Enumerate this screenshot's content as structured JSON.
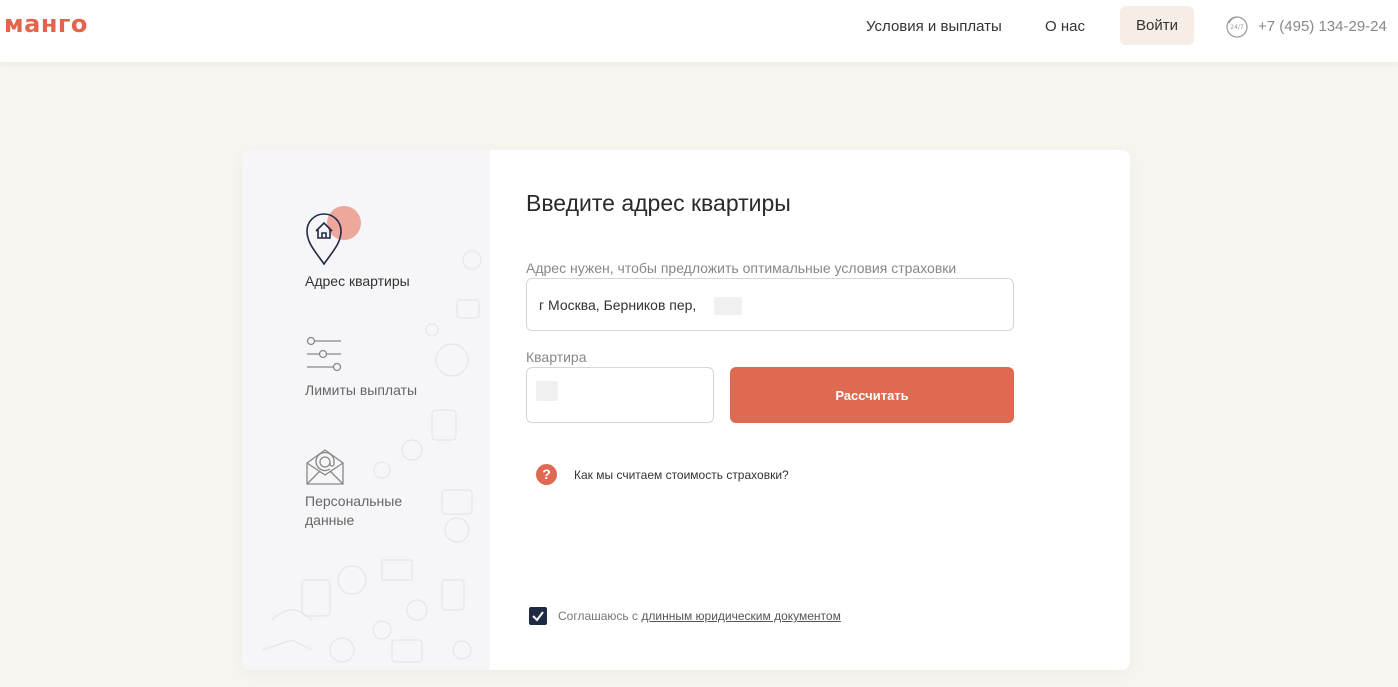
{
  "header": {
    "logo": "манго",
    "nav": {
      "terms": "Условия и выплаты",
      "about": "О нас"
    },
    "login_label": "Войти",
    "phone": "+7 (495) 134-29-24",
    "support_icon": "support-24-7-icon",
    "support_badge": "24/7"
  },
  "sidebar": {
    "steps": [
      {
        "label": "Адрес квартиры",
        "icon": "home-pin-icon",
        "active": true
      },
      {
        "label": "Лимиты выплаты",
        "icon": "sliders-icon",
        "active": false
      },
      {
        "label": "Персональные данные",
        "icon": "envelope-at-icon",
        "active": false
      }
    ]
  },
  "form": {
    "title": "Введите адрес квартиры",
    "address_hint": "Адрес нужен, чтобы предложить оптимальные условия страховки",
    "address_value": "г Москва, Берников пер,",
    "apartment_label": "Квартира",
    "apartment_value": "",
    "calculate_label": "Рассчитать",
    "help_text": "Как мы считаем стоимость страховки?",
    "agree_prefix": "Соглашаюсь с ",
    "agree_link": "длинным юридическим документом",
    "agree_checked": true
  },
  "colors": {
    "accent": "#de6a52",
    "logo": "#e1654c",
    "background": "#f8f4f0",
    "checkbox": "#1f2a44"
  }
}
